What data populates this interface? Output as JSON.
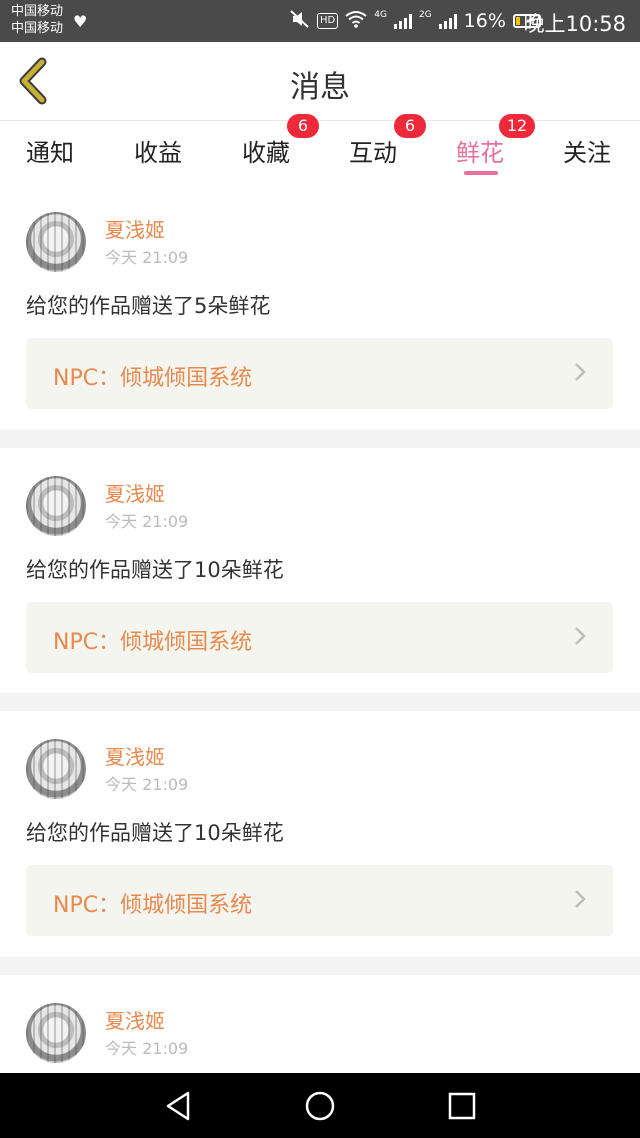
{
  "status_bar": {
    "carrier_1": "中国移动",
    "carrier_2": "中国移动",
    "hd_label": "HD",
    "net_4g": "4G",
    "net_2g": "2G",
    "battery_percent": "16%",
    "time": "晚上10:58",
    "battery_fill_fraction": 0.16
  },
  "header": {
    "title": "消息",
    "back_icon": "chevron-left-icon",
    "back_color": "#c8b037"
  },
  "tabs": [
    {
      "label": "通知",
      "badge": ""
    },
    {
      "label": "收益",
      "badge": ""
    },
    {
      "label": "收藏",
      "badge": "6"
    },
    {
      "label": "互动",
      "badge": "6"
    },
    {
      "label": "鲜花",
      "badge": "12",
      "active": true
    },
    {
      "label": "关注",
      "badge": ""
    }
  ],
  "messages": [
    {
      "username": "夏浅姬",
      "time": "今天 21:09",
      "text": "给您的作品赠送了5朵鲜花",
      "work": "NPC：倾城倾国系统"
    },
    {
      "username": "夏浅姬",
      "time": "今天 21:09",
      "text": "给您的作品赠送了10朵鲜花",
      "work": "NPC：倾城倾国系统"
    },
    {
      "username": "夏浅姬",
      "time": "今天 21:09",
      "text": "给您的作品赠送了10朵鲜花",
      "work": "NPC：倾城倾国系统"
    },
    {
      "username": "夏浅姬",
      "time": "今天 21:09",
      "text": "",
      "work": ""
    }
  ],
  "colors": {
    "accent_pink": "#e8709c",
    "name_orange": "#e8894e",
    "badge_red": "#ee2a3a"
  },
  "nav_bar": {
    "back_icon": "triangle-back-icon",
    "home_icon": "circle-home-icon",
    "recents_icon": "square-recents-icon"
  }
}
